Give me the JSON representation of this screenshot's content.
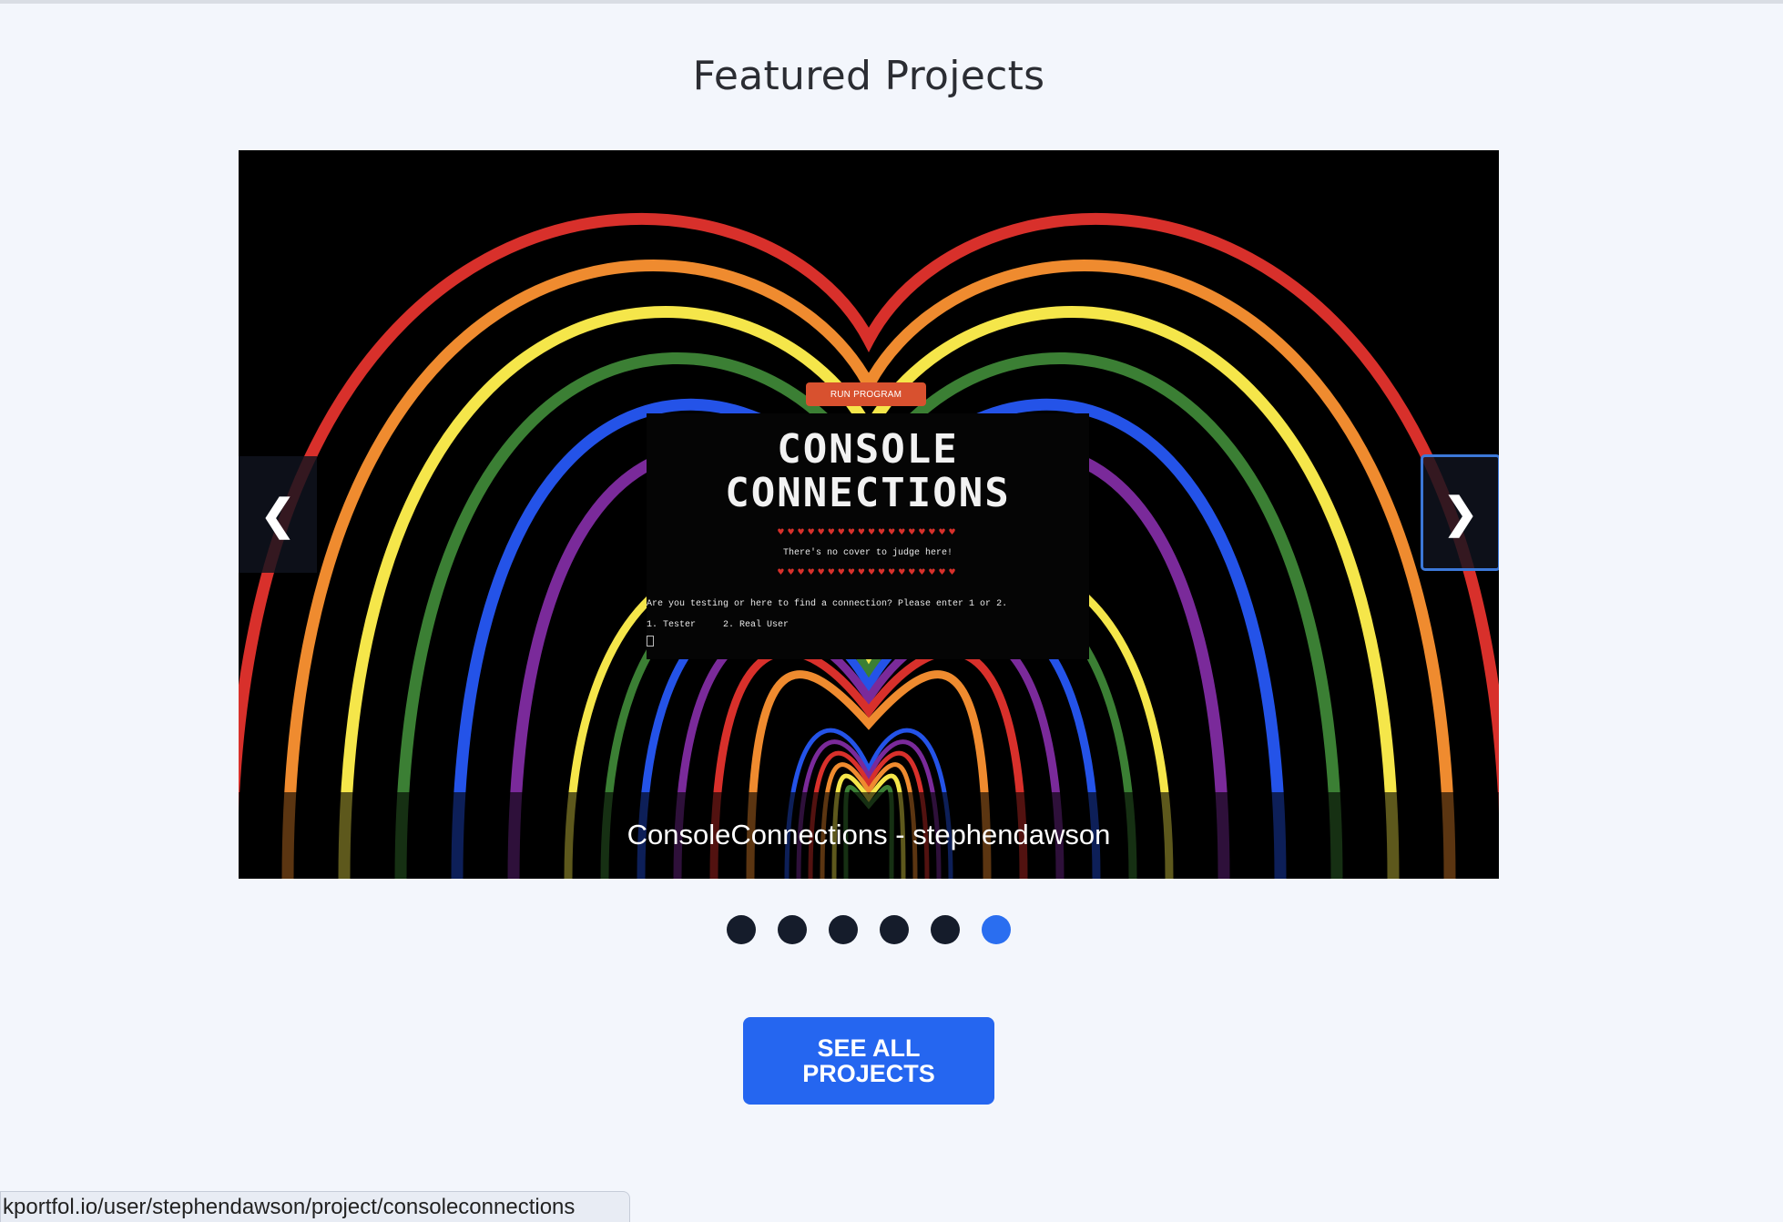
{
  "section": {
    "heading": "Featured Projects"
  },
  "carousel": {
    "slide_caption": "ConsoleConnections - stephendawson",
    "prev_glyph": "❮",
    "next_glyph": "❯",
    "active_index": 6,
    "slide_count": 6,
    "dots": [
      {
        "active": false
      },
      {
        "active": false
      },
      {
        "active": false
      },
      {
        "active": false
      },
      {
        "active": false
      },
      {
        "active": true
      }
    ],
    "screenshot": {
      "run_button": "RUN PROGRAM",
      "logo_line1": "CONSOLE",
      "logo_line2": "CONNECTIONS",
      "hearts": "♥♥♥♥♥♥♥♥♥♥♥♥♥♥♥♥♥♥",
      "tagline": "There's no cover to judge here!",
      "prompt": "Are you testing or here to find a connection? Please enter 1 or 2.",
      "options": "1. Tester     2. Real User"
    }
  },
  "cta": {
    "label_line1": "SEE ALL",
    "label_line2": "PROJECTS"
  },
  "status_bar": {
    "url": "kportfol.io/user/stephendawson/project/consoleconnections"
  },
  "colors": {
    "background": "#f3f6fc",
    "accent": "#2566f0",
    "dot_inactive": "#151c2b",
    "rainbow": [
      "#d8302b",
      "#ef8b2f",
      "#f5e64a",
      "#3b7f34",
      "#2453e8",
      "#7a2a9a"
    ]
  }
}
